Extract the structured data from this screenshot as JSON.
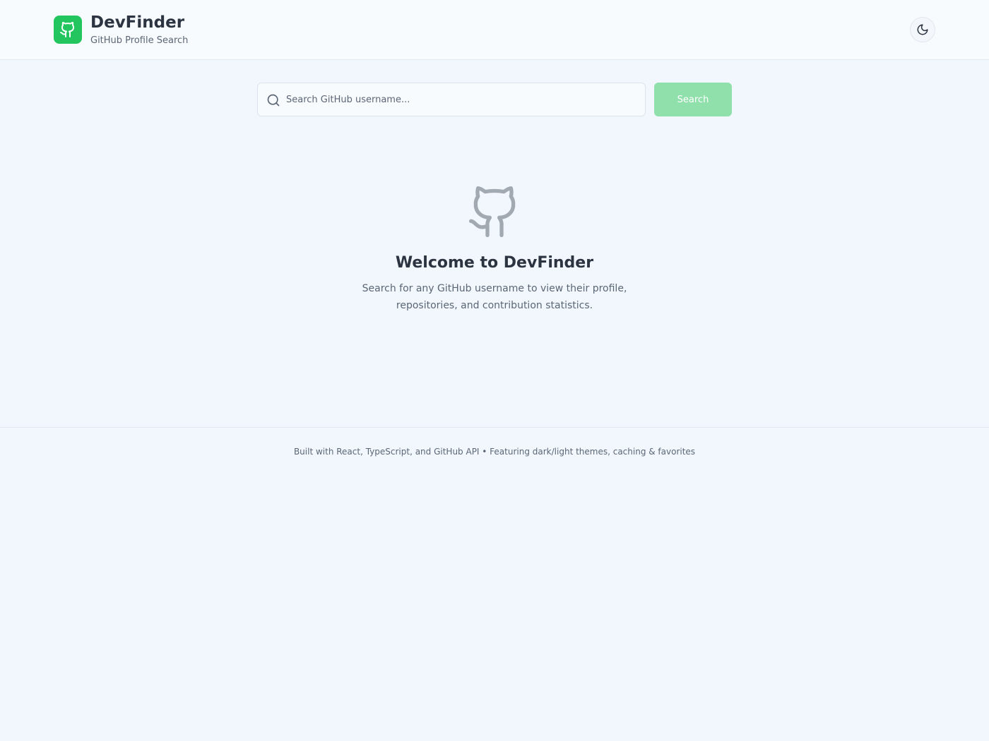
{
  "header": {
    "title": "DevFinder",
    "subtitle": "GitHub Profile Search",
    "logo_icon": "github-icon",
    "theme_toggle_icon": "moon-icon"
  },
  "search": {
    "placeholder": "Search GitHub username...",
    "value": "",
    "button_label": "Search",
    "icon": "search-icon"
  },
  "welcome": {
    "icon": "github-icon",
    "title": "Welcome to DevFinder",
    "text": "Search for any GitHub username to view their profile, repositories, and contribution statistics."
  },
  "footer": {
    "text": "Built with React, TypeScript, and GitHub API • Featuring dark/light themes, caching & favorites"
  },
  "colors": {
    "accent": "#22c55e",
    "button_disabled": "#90e0ac",
    "background": "#f2f7fd"
  }
}
